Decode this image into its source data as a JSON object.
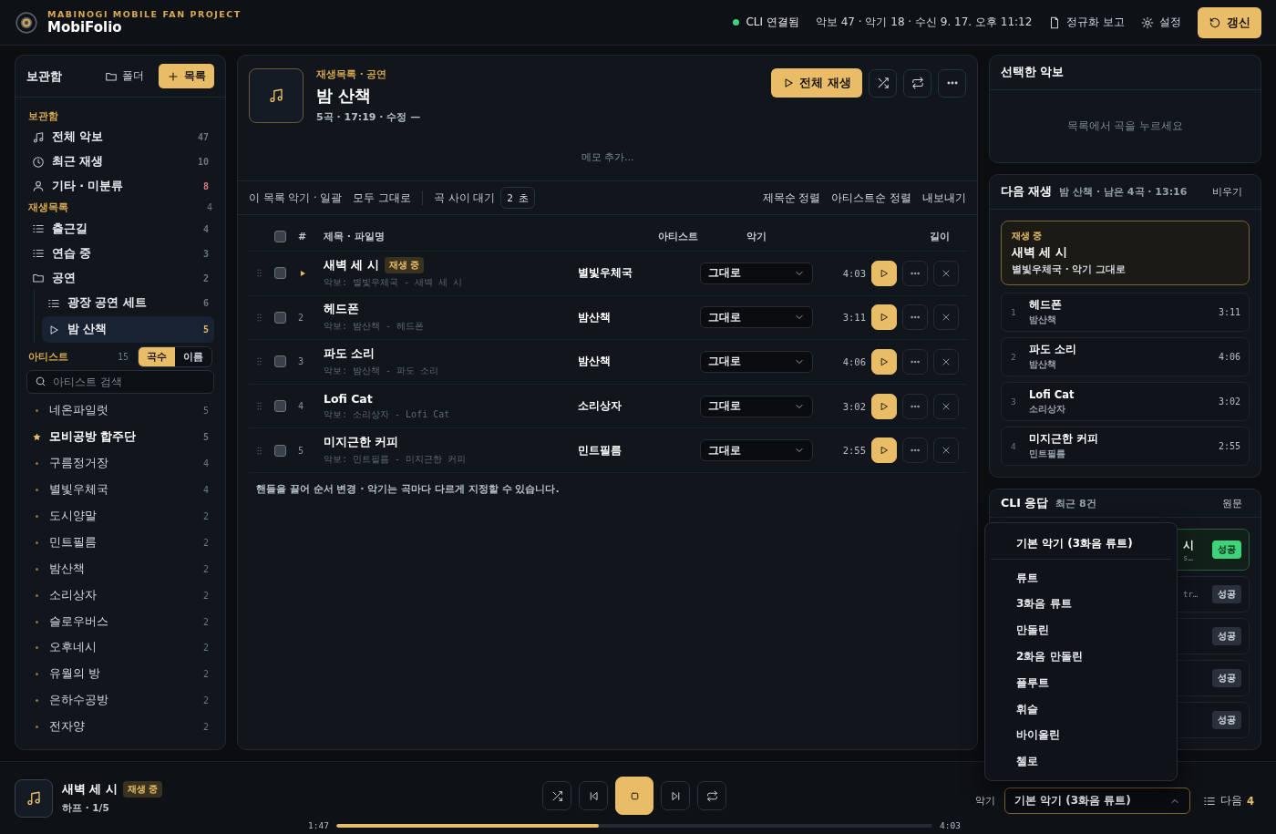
{
  "header": {
    "tagline": "MABINOGI MOBILE FAN PROJECT",
    "title": "MobiFolio",
    "cli": {
      "connected": true,
      "label": "CLI 연결됨"
    },
    "stats": "악보 47 · 악기 18 · 수신 9. 17. 오후 11:12",
    "actions": [
      {
        "kind": "report",
        "label": "정규화 보고"
      },
      {
        "kind": "settings",
        "label": "설정"
      },
      {
        "kind": "refresh",
        "label": "갱신"
      }
    ]
  },
  "sidebar": {
    "title": "보관함",
    "buttons": [
      {
        "kind": "folder",
        "label": "폴더"
      },
      {
        "kind": "add",
        "label": "목록"
      }
    ],
    "library": {
      "label": "보관함",
      "items": [
        {
          "kind": "music",
          "label": "전체 악보",
          "count": "47",
          "warn": false,
          "selected": false
        },
        {
          "kind": "clock",
          "label": "최근 재생",
          "count": "10",
          "warn": false,
          "selected": false
        },
        {
          "kind": "person",
          "label": "기타 · 미분류",
          "count": "8",
          "warn": true,
          "selected": false
        }
      ]
    },
    "playlists": {
      "label": "재생목록",
      "count": "4",
      "items": [
        {
          "kind": "list",
          "label": "출근길",
          "count": "4",
          "selected": false
        },
        {
          "kind": "list",
          "label": "연습 중",
          "count": "3",
          "selected": false
        },
        {
          "kind": "folder",
          "label": "공연",
          "count": "2",
          "selected": false,
          "children": [
            {
              "kind": "list",
              "label": "광장 공연 세트",
              "count": "6",
              "selected": false
            },
            {
              "kind": "play",
              "label": "밤 산책",
              "count": "5",
              "selected": true
            }
          ]
        }
      ]
    },
    "artists": {
      "label": "아티스트",
      "count": "15",
      "sort": [
        {
          "label": "곡수",
          "selected": true
        },
        {
          "label": "이름",
          "selected": false
        }
      ],
      "search": {
        "placeholder": "아티스트 검색"
      },
      "items": [
        {
          "name": "네온파일럿",
          "count": "5",
          "starred": false
        },
        {
          "name": "모비공방 합주단",
          "count": "5",
          "starred": true
        },
        {
          "name": "구름정거장",
          "count": "4",
          "starred": false
        },
        {
          "name": "별빛우체국",
          "count": "4",
          "starred": false
        },
        {
          "name": "도시양말",
          "count": "2",
          "starred": false
        },
        {
          "name": "민트필름",
          "count": "2",
          "starred": false
        },
        {
          "name": "밤산책",
          "count": "2",
          "starred": false
        },
        {
          "name": "소리상자",
          "count": "2",
          "starred": false
        },
        {
          "name": "슬로우버스",
          "count": "2",
          "starred": false
        },
        {
          "name": "오후네시",
          "count": "2",
          "starred": false
        },
        {
          "name": "유월의 방",
          "count": "2",
          "starred": false
        },
        {
          "name": "은하수공방",
          "count": "2",
          "starred": false
        },
        {
          "name": "전자양",
          "count": "2",
          "starred": false
        }
      ]
    }
  },
  "playlist": {
    "breadcrumb": "재생목록 · 공연",
    "title": "밤 산책",
    "meta": "5곡 · 17:19 · 수정 —",
    "play_all": "전체 재생",
    "memo": {
      "placeholder": "메모 추가..."
    },
    "toolbar": {
      "bulk_label": "이 목록 악기 · 일괄",
      "bulk_button": "모두 그대로",
      "gap_label": "곡 사이 대기",
      "gap_value": "2 초",
      "actions": [
        "제목순 정렬",
        "아티스트순 정렬",
        "내보내기"
      ]
    },
    "columns": {
      "number": "#",
      "title": "제목 · 파일명",
      "artist": "아티스트",
      "instrument": "악기",
      "length": "길이"
    },
    "all_checked": false,
    "rows": [
      {
        "playing": true,
        "checked": false,
        "title": "새벽 세 시",
        "badge": "재생 중",
        "file": "악보: 별빛우체국 - 새벽 세 시",
        "artist": "별빛우체국",
        "instrument": "그대로",
        "length": "4:03"
      },
      {
        "playing": false,
        "checked": false,
        "number": "2",
        "title": "헤드폰",
        "file": "악보: 밤산책 - 헤드폰",
        "artist": "밤산책",
        "instrument": "그대로",
        "length": "3:11"
      },
      {
        "playing": false,
        "checked": false,
        "number": "3",
        "title": "파도 소리",
        "file": "악보: 밤산책 - 파도 소리",
        "artist": "밤산책",
        "instrument": "그대로",
        "length": "4:06"
      },
      {
        "playing": false,
        "checked": false,
        "number": "4",
        "title": "Lofi Cat",
        "file": "악보: 소리상자 - Lofi Cat",
        "artist": "소리상자",
        "instrument": "그대로",
        "length": "3:02"
      },
      {
        "playing": false,
        "checked": false,
        "number": "5",
        "title": "미지근한 커피",
        "file": "악보: 민트필름 - 미지근한 커피",
        "artist": "민트필름",
        "instrument": "그대로",
        "length": "2:55"
      }
    ],
    "hint": "핸들을 끌어 순서 변경 · 악기는 곡마다 다르게 지정할 수 있습니다."
  },
  "selected_score": {
    "title": "선택한 악보",
    "empty": "목록에서 곡을 누르세요"
  },
  "queue": {
    "title": "다음 재생",
    "summary": "밤 산책 · 남은 4곡 · 13:16",
    "action": "비우기",
    "now": {
      "label": "재생 중",
      "title": "새벽 세 시",
      "detail": "별빛우체국 · 악기 그대로"
    },
    "items": [
      {
        "number": "1",
        "title": "헤드폰",
        "artist": "밤산책",
        "length": "3:11"
      },
      {
        "number": "2",
        "title": "파도 소리",
        "artist": "밤산책",
        "length": "4:06"
      },
      {
        "number": "3",
        "title": "Lofi Cat",
        "artist": "소리상자",
        "length": "3:02"
      },
      {
        "number": "4",
        "title": "미지근한 커피",
        "artist": "민트필름",
        "length": "2:55"
      }
    ]
  },
  "cli_log": {
    "title": "CLI 응답",
    "summary": "최근 8건",
    "action": "원문",
    "rows": [
      {
        "title": "시",
        "detail": "s…",
        "status": "성공",
        "selected": true
      },
      {
        "detail": "tr…",
        "status": "성공",
        "selected": false
      },
      {
        "status": "성공",
        "selected": false
      },
      {
        "status": "성공",
        "selected": false
      },
      {
        "status": "성공",
        "selected": false
      }
    ]
  },
  "player": {
    "title": "새벽 세 시",
    "badge": "재생 중",
    "detail": "하프 · 1/5",
    "playing": true,
    "elapsed": "1:47",
    "total": "4:03",
    "level": 0.44,
    "instrument_label": "악기",
    "instrument": {
      "value": "기본 악기 (3화음 류트)",
      "expanded": true,
      "options": [
        {
          "kind": "default",
          "label": "기본 악기 (3화음 류트)",
          "selected": true
        },
        {
          "kind": "option",
          "label": "류트",
          "selected": false
        },
        {
          "kind": "option",
          "label": "3화음 류트",
          "selected": false
        },
        {
          "kind": "option",
          "label": "만돌린",
          "selected": false
        },
        {
          "kind": "option",
          "label": "2화음 만돌린",
          "selected": false
        },
        {
          "kind": "option",
          "label": "플루트",
          "selected": false
        },
        {
          "kind": "option",
          "label": "휘슬",
          "selected": false
        },
        {
          "kind": "option",
          "label": "바이올린",
          "selected": false
        },
        {
          "kind": "option",
          "label": "첼로",
          "selected": false
        }
      ]
    },
    "next": {
      "label": "다음",
      "count": "4"
    }
  }
}
